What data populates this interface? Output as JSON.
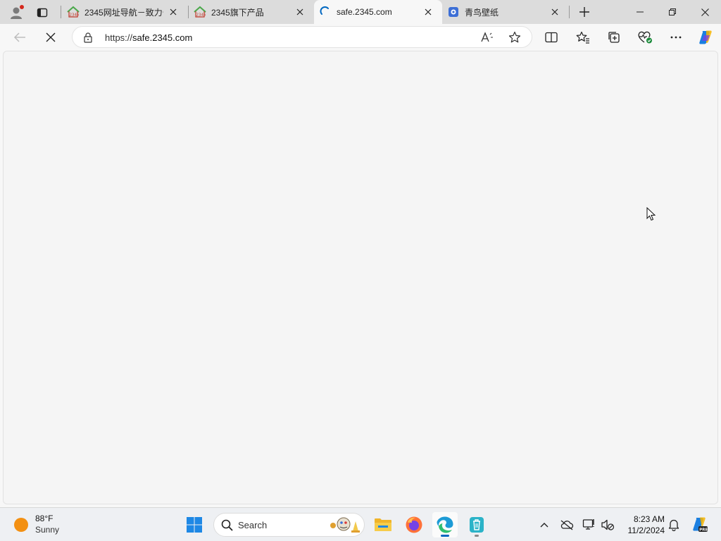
{
  "browser": {
    "tabs": [
      {
        "title": "2345网址导航－致力于",
        "favicon": "2345-house-icon",
        "active": false
      },
      {
        "title": "2345旗下产品",
        "favicon": "2345-house-icon",
        "active": false
      },
      {
        "title": "safe.2345.com",
        "favicon": "loading-spinner-icon",
        "active": true
      },
      {
        "title": "青鸟壁纸",
        "favicon": "qingniao-app-icon",
        "active": false
      }
    ],
    "address": {
      "scheme": "https://",
      "host": "safe.2345.com"
    },
    "read_aloud_label": "Ă"
  },
  "taskbar": {
    "weather": {
      "temp": "88°F",
      "condition": "Sunny"
    },
    "search_label": "Search",
    "clock": {
      "time": "8:23 AM",
      "date": "11/2/2024"
    }
  },
  "colors": {
    "edge_accent": "#0067c0",
    "profile_badge": "#d4281c",
    "sun": "#f39012"
  }
}
